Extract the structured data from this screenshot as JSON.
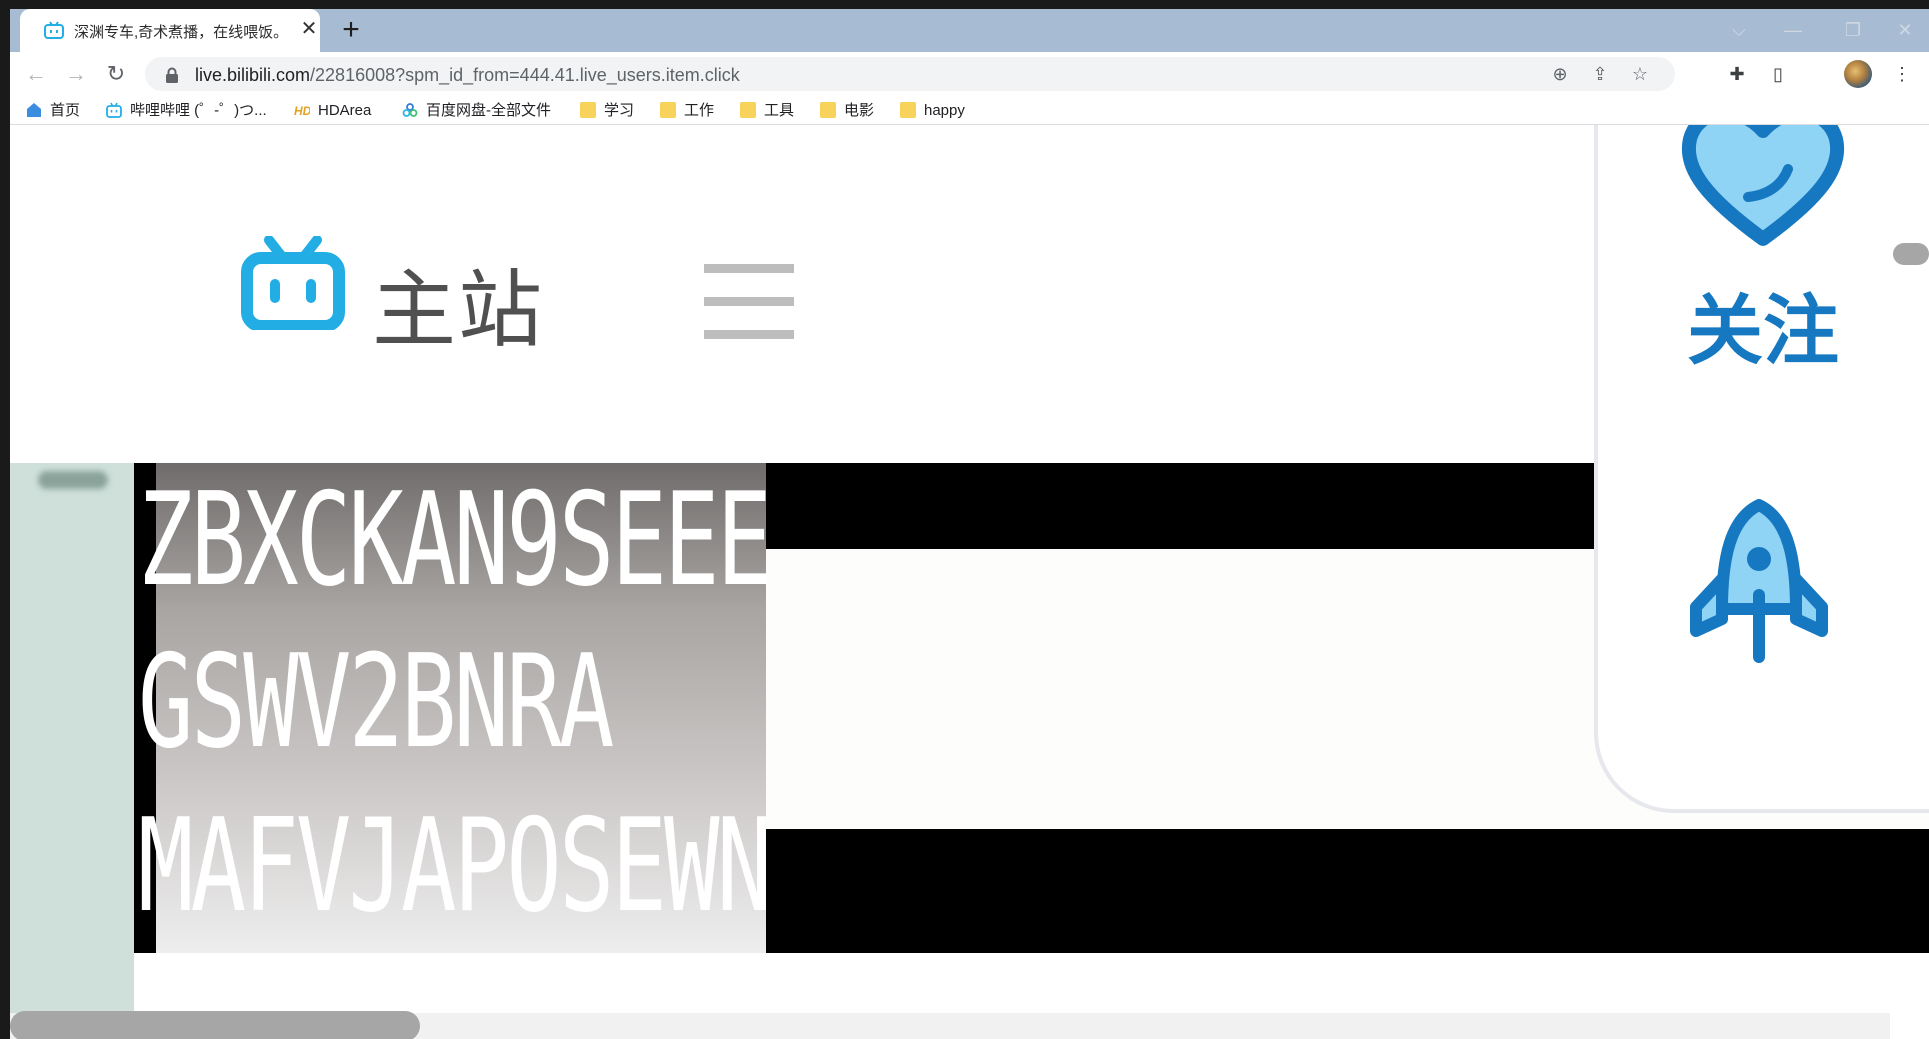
{
  "tab": {
    "title": "深渊专车,奇术煮播，在线喂饭。",
    "close": "✕"
  },
  "newtab": "+",
  "window_controls": {
    "tabsearch": "⌵",
    "minimize": "—",
    "restore": "❐",
    "close": "✕"
  },
  "nav": {
    "back": "←",
    "forward": "→",
    "reload": "↻"
  },
  "address": {
    "host": "live.bilibili.com",
    "path": "/22816008?spm_id_from=444.41.live_users.item.click"
  },
  "omnibox_icons": {
    "zoom": "⊕",
    "share": "⇪",
    "star": "☆"
  },
  "toolbar_icons": {
    "extensions": "✚",
    "sidepanel": "▯",
    "menu": "⋮"
  },
  "bookmarks": [
    {
      "label": "首页",
      "icon": "home-icon"
    },
    {
      "label": "哔哩哔哩 (゜-゜)つ...",
      "icon": "bilibili-icon"
    },
    {
      "label": "HDArea",
      "icon": "hdarea-icon"
    },
    {
      "label": "百度网盘-全部文件",
      "icon": "baidu-cloud-icon"
    },
    {
      "label": "学习",
      "icon": "folder-icon"
    },
    {
      "label": "工作",
      "icon": "folder-icon"
    },
    {
      "label": "工具",
      "icon": "folder-icon"
    },
    {
      "label": "电影",
      "icon": "folder-icon"
    },
    {
      "label": "happy",
      "icon": "folder-icon"
    }
  ],
  "site": {
    "logo_text": "主站"
  },
  "captcha": {
    "lines": [
      "ZBXCKAN9SEEE",
      "GSWV2BNRA",
      "MAFVJAPOSEWN"
    ]
  },
  "side_panel": {
    "follow_label": "关注"
  },
  "colors": {
    "bilibili_blue": "#23ade5",
    "panel_blue": "#1678c0",
    "heart_fill": "#6cc4f1"
  }
}
